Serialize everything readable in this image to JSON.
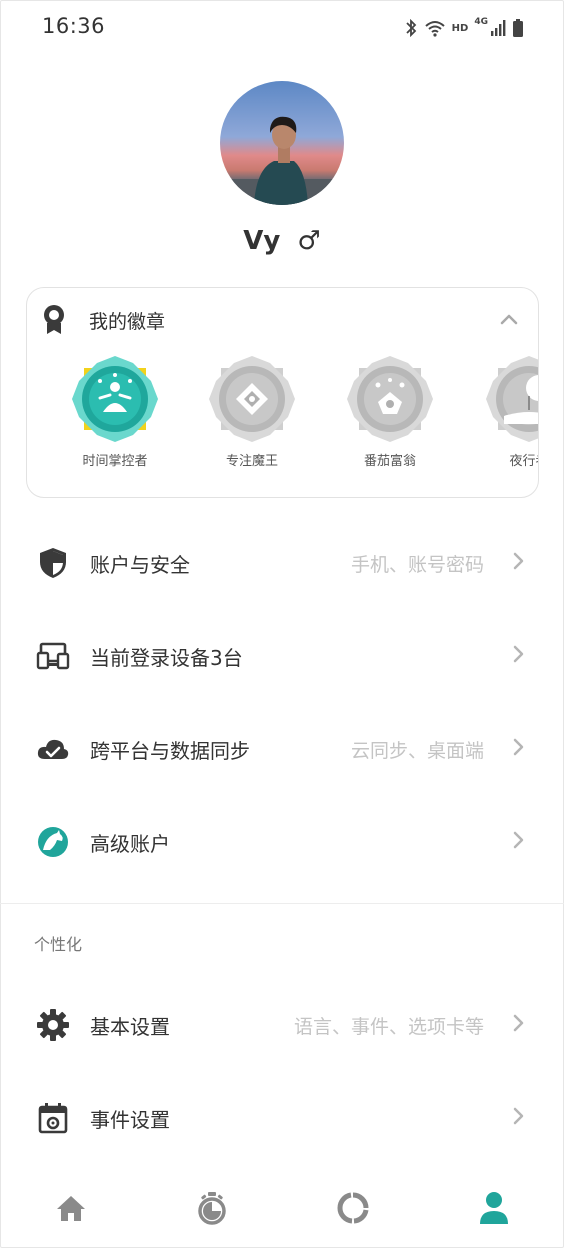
{
  "status_bar": {
    "time": "16:36",
    "hd_label": "HD",
    "network_label": "4G",
    "icons": [
      "bluetooth-icon",
      "wifi-icon",
      "signal-icon",
      "battery-icon"
    ]
  },
  "profile": {
    "username": "Vy",
    "gender_symbol": "♂"
  },
  "badges": {
    "title": "我的徽章",
    "items": [
      {
        "name": "时间掌控者",
        "earned": true
      },
      {
        "name": "专注魔王",
        "earned": false
      },
      {
        "name": "番茄富翁",
        "earned": false
      },
      {
        "name": "夜行者",
        "earned": false
      }
    ]
  },
  "menu": [
    {
      "label": "账户与安全",
      "hint": "手机、账号密码",
      "icon": "shield-icon"
    },
    {
      "label": "当前登录设备3台",
      "hint": "",
      "icon": "devices-icon"
    },
    {
      "label": "跨平台与数据同步",
      "hint": "云同步、桌面端",
      "icon": "cloud-sync-icon"
    },
    {
      "label": "高级账户",
      "hint": "",
      "icon": "premium-horse-icon"
    }
  ],
  "personalization": {
    "title": "个性化",
    "items": [
      {
        "label": "基本设置",
        "hint": "语言、事件、选项卡等",
        "icon": "gear-icon"
      },
      {
        "label": "事件设置",
        "hint": "",
        "icon": "calendar-gear-icon"
      }
    ]
  },
  "tab_bar": {
    "tabs": [
      "home-icon",
      "timer-icon",
      "stats-ring-icon",
      "profile-icon"
    ],
    "active_index": 3
  },
  "colors": {
    "accent": "#20a59b",
    "text": "#333333",
    "hint": "#c4c4c4",
    "icon_inactive": "#8a8a8a",
    "badge_gold": "#f2d21b"
  }
}
